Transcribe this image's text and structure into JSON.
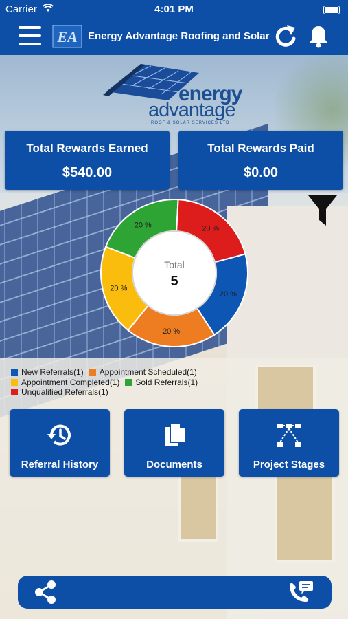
{
  "status_bar": {
    "carrier": "Carrier",
    "time": "4:01 PM"
  },
  "nav": {
    "logo_text": "EA",
    "title": "Energy Advantage Roofing and Solar"
  },
  "brand": {
    "line1": "energy",
    "line2": "advantage",
    "tagline": "ROOF & SOLAR SERVICES LTD"
  },
  "cards": [
    {
      "label": "Total Rewards Earned",
      "value": "$540.00"
    },
    {
      "label": "Total Rewards Paid",
      "value": "$0.00"
    }
  ],
  "donut": {
    "center_label": "Total",
    "center_value": "5",
    "slices": [
      {
        "name": "New Referrals",
        "value": 20,
        "label": "20 %",
        "color": "#0d56b3"
      },
      {
        "name": "Appointment Scheduled",
        "value": 20,
        "label": "20 %",
        "color": "#ee7c21"
      },
      {
        "name": "Appointment Completed",
        "value": 20,
        "label": "20 %",
        "color": "#fbbd0d"
      },
      {
        "name": "Sold Referrals",
        "value": 20,
        "label": "20 %",
        "color": "#2ea434"
      },
      {
        "name": "Unqualified Referrals",
        "value": 20,
        "label": "20 %",
        "color": "#dd1c1c"
      }
    ]
  },
  "legend": [
    {
      "label": "New Referrals(1)",
      "color": "#0d56b3"
    },
    {
      "label": "Appointment Scheduled(1)",
      "color": "#ee7c21"
    },
    {
      "label": "Appointment Completed(1)",
      "color": "#fbbd0d"
    },
    {
      "label": "Sold Referrals(1)",
      "color": "#2ea434"
    },
    {
      "label": "Unqualified Referrals(1)",
      "color": "#dd1c1c"
    }
  ],
  "tiles": [
    {
      "label": "Referral History",
      "icon": "history-icon"
    },
    {
      "label": "Documents",
      "icon": "documents-icon"
    },
    {
      "label": "Project Stages",
      "icon": "project-stages-icon"
    }
  ],
  "bottom_bar": {
    "share_icon": "share-icon",
    "chat_icon": "phone-chat-icon"
  },
  "colors": {
    "primary": "#0d4ea6"
  }
}
